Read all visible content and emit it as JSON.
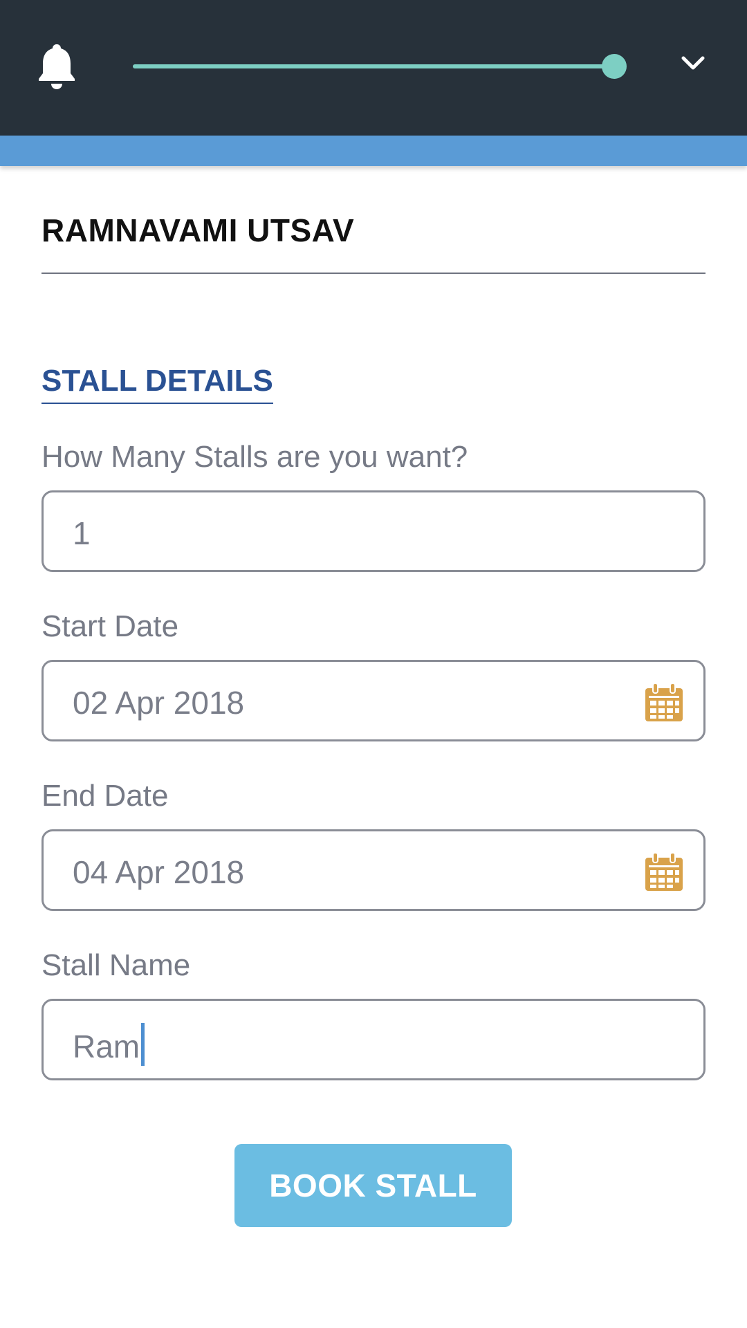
{
  "header": {
    "notifications_icon": "bell-icon",
    "progress_percent": 100,
    "menu_icon": "chevron-down-icon",
    "progress_color": "#7dcfc3",
    "background_color": "#27313a",
    "accent_color": "#5a9bd6"
  },
  "event": {
    "title": "RAMNAVAMI UTSAV"
  },
  "form": {
    "section_title": "STALL DETAILS",
    "stall_count": {
      "label": "How Many Stalls are you want?",
      "value": "1"
    },
    "start_date": {
      "label": "Start Date",
      "value": "02 Apr 2018",
      "icon": "calendar-icon"
    },
    "end_date": {
      "label": "End Date",
      "value": "04 Apr 2018",
      "icon": "calendar-icon"
    },
    "stall_name": {
      "label": "Stall Name",
      "value": "Ram"
    },
    "submit_label": "BOOK STALL",
    "calendar_icon_color": "#d9a24a",
    "button_color": "#6bbde2",
    "section_title_color": "#2a5193"
  }
}
